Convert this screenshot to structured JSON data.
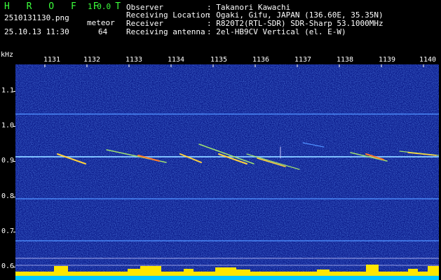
{
  "app": {
    "name": "H R O F F T",
    "version": "1.0.0"
  },
  "file": {
    "name": "2510131130.png",
    "datetime": "25.10.13 11:30"
  },
  "meteor": {
    "label": "meteor",
    "count": "64"
  },
  "info": [
    {
      "label": "Observer",
      "value": ": Takanori Kawachi"
    },
    {
      "label": "Receiving Location",
      "value": ": Ogaki, Gifu, JAPAN (136.60E, 35.35N)"
    },
    {
      "label": "Receiver",
      "value": ": R820T2(RTL-SDR) SDR-Sharp 53.1000MHz"
    },
    {
      "label": "Receiving antenna",
      "value": ": 2el-HB9CV Vertical (el. E-W)"
    }
  ],
  "axis": {
    "unit": "kHz",
    "x_ticks": [
      "1131",
      "1132",
      "1133",
      "1134",
      "1135",
      "1136",
      "1137",
      "1138",
      "1139",
      "1140"
    ],
    "y_ticks": [
      "1.1",
      "1.0",
      "0.9",
      "0.8",
      "0.7",
      "0.6"
    ]
  },
  "colors": {
    "background": "#000000",
    "spectrogram": "#0a1a8a",
    "noise_line": "#6aa8ff",
    "meteor_trail": "#ffd23c",
    "signal_bars": "#ffe600",
    "signal_floor": "#00c8ff",
    "title_green": "#3cff3c"
  }
}
